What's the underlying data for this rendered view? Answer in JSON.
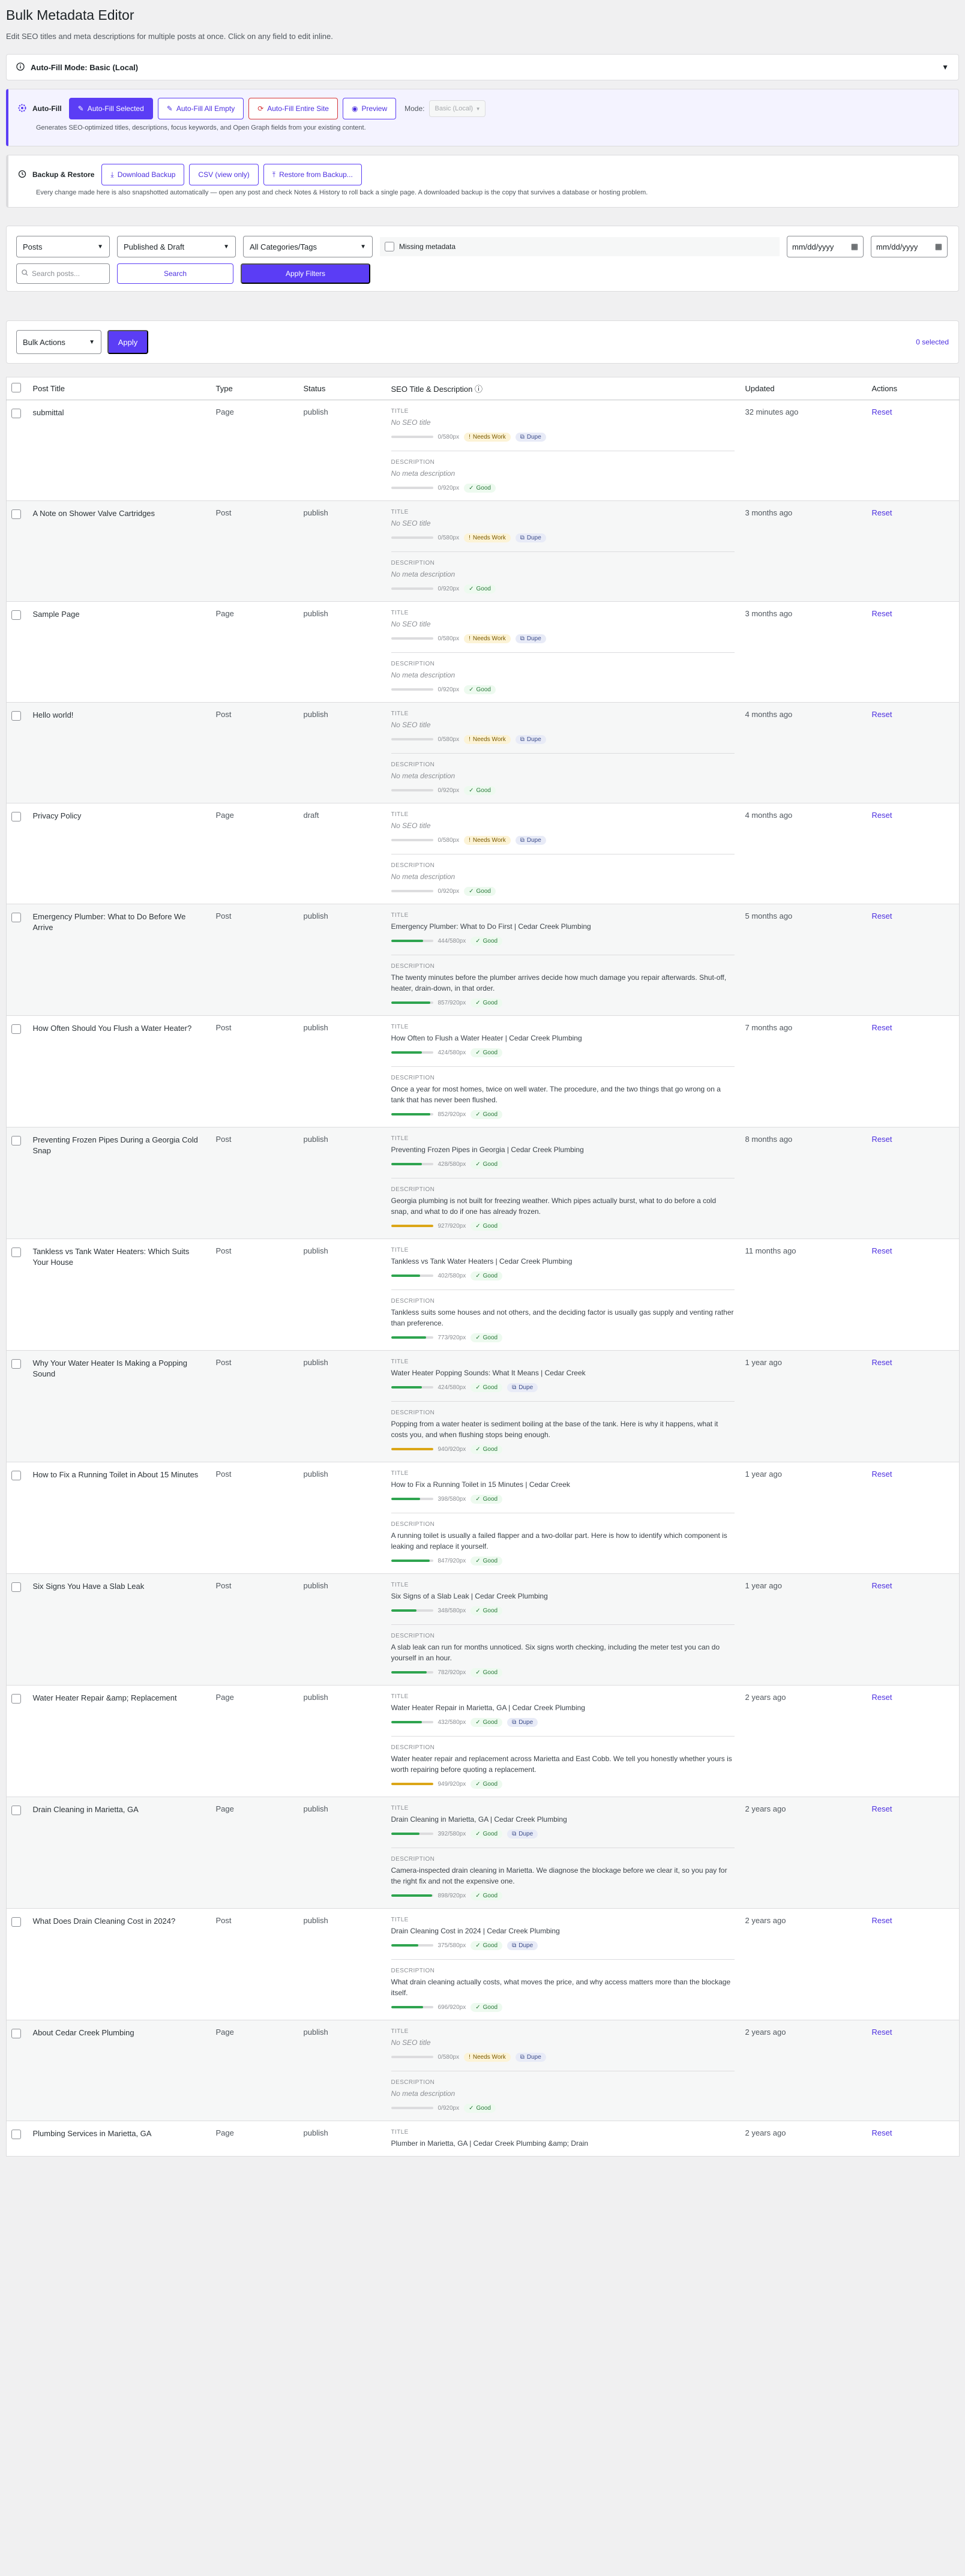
{
  "header": {
    "title": "Bulk Metadata Editor",
    "subtitle": "Edit SEO titles and meta descriptions for multiple posts at once. Click on any field to edit inline."
  },
  "autofill_mode": {
    "label": "Auto-Fill Mode: Basic (Local)",
    "expanded": false
  },
  "autofill": {
    "section_label": "Auto-Fill",
    "buttons": [
      "Auto-Fill Selected",
      "Auto-Fill All Empty",
      "Auto-Fill Entire Site",
      "Preview"
    ],
    "mode_label": "Mode:",
    "mode_value": "Basic (Local)",
    "help": "Generates SEO-optimized titles, descriptions, focus keywords, and Open Graph fields from your existing content."
  },
  "backup": {
    "section_label": "Backup & Restore",
    "buttons": [
      "Download Backup",
      "CSV (view only)",
      "Restore from Backup..."
    ],
    "help": "Every change made here is also snapshotted automatically — open any post and check Notes & History to roll back a single page. A downloaded backup is the copy that survives a database or hosting problem."
  },
  "filters": {
    "post_type": "Posts",
    "status": "Published & Draft",
    "category": "All Categories/Tags",
    "missing_label": "Missing metadata",
    "date_from": "mm/dd/yyyy",
    "date_to": "mm/dd/yyyy",
    "search_placeholder": "Search posts...",
    "search_label": "Search",
    "apply_label": "Apply Filters"
  },
  "bulk": {
    "action": "Bulk Actions",
    "apply": "Apply",
    "selected": "0 selected"
  },
  "table": {
    "columns": [
      "Post Title",
      "Type",
      "Status",
      "SEO Title & Description ⓘ",
      "Updated",
      "Actions"
    ],
    "title_label": "TITLE",
    "desc_label": "DESCRIPTION",
    "reset_label": "Reset",
    "badges": {
      "good": "Good",
      "needs": "Needs Work",
      "dupe": "Dupe"
    },
    "rows": [
      {
        "title": "submittal",
        "type": "Page",
        "status": "publish",
        "seo_title": "No SEO title",
        "title_px": "0/580px",
        "title_fill": 0,
        "title_badges": [
          "needs",
          "dupe"
        ],
        "desc": "No meta description",
        "desc_px": "0/920px",
        "desc_fill": 0,
        "desc_badges": [
          "good"
        ],
        "updated": "32 minutes ago"
      },
      {
        "title": "A Note on Shower Valve Cartridges",
        "type": "Post",
        "status": "publish",
        "seo_title": "No SEO title",
        "title_px": "0/580px",
        "title_fill": 0,
        "title_badges": [
          "needs",
          "dupe"
        ],
        "desc": "No meta description",
        "desc_px": "0/920px",
        "desc_fill": 0,
        "desc_badges": [
          "good"
        ],
        "updated": "3 months ago"
      },
      {
        "title": "Sample Page",
        "type": "Page",
        "status": "publish",
        "seo_title": "No SEO title",
        "title_px": "0/580px",
        "title_fill": 0,
        "title_badges": [
          "needs",
          "dupe"
        ],
        "desc": "No meta description",
        "desc_px": "0/920px",
        "desc_fill": 0,
        "desc_badges": [
          "good"
        ],
        "updated": "3 months ago"
      },
      {
        "title": "Hello world!",
        "type": "Post",
        "status": "publish",
        "seo_title": "No SEO title",
        "title_px": "0/580px",
        "title_fill": 0,
        "title_badges": [
          "needs",
          "dupe"
        ],
        "desc": "No meta description",
        "desc_px": "0/920px",
        "desc_fill": 0,
        "desc_badges": [
          "good"
        ],
        "updated": "4 months ago"
      },
      {
        "title": "Privacy Policy",
        "type": "Page",
        "status": "draft",
        "seo_title": "No SEO title",
        "title_px": "0/580px",
        "title_fill": 0,
        "title_badges": [
          "needs",
          "dupe"
        ],
        "desc": "No meta description",
        "desc_px": "0/920px",
        "desc_fill": 0,
        "desc_badges": [
          "good"
        ],
        "updated": "4 months ago"
      },
      {
        "title": "Emergency Plumber: What to Do Before We Arrive",
        "type": "Post",
        "status": "publish",
        "seo_title": "Emergency Plumber: What to Do First | Cedar Creek Plumbing",
        "title_px": "444/580px",
        "title_fill": 0.77,
        "title_badges": [
          "good"
        ],
        "desc": "The twenty minutes before the plumber arrives decide how much damage you repair afterwards. Shut-off, heater, drain-down, in that order.",
        "desc_px": "857/920px",
        "desc_fill": 0.93,
        "desc_badges": [
          "good"
        ],
        "updated": "5 months ago"
      },
      {
        "title": "How Often Should You Flush a Water Heater?",
        "type": "Post",
        "status": "publish",
        "seo_title": "How Often to Flush a Water Heater | Cedar Creek Plumbing",
        "title_px": "424/580px",
        "title_fill": 0.73,
        "title_badges": [
          "good"
        ],
        "desc": "Once a year for most homes, twice on well water. The procedure, and the two things that go wrong on a tank that has never been flushed.",
        "desc_px": "852/920px",
        "desc_fill": 0.93,
        "desc_badges": [
          "good"
        ],
        "updated": "7 months ago"
      },
      {
        "title": "Preventing Frozen Pipes During a Georgia Cold Snap",
        "type": "Post",
        "status": "publish",
        "seo_title": "Preventing Frozen Pipes in Georgia | Cedar Creek Plumbing",
        "title_px": "428/580px",
        "title_fill": 0.74,
        "title_badges": [
          "good"
        ],
        "desc": "Georgia plumbing is not built for freezing weather. Which pipes actually burst, what to do before a cold snap, and what to do if one has already frozen.",
        "desc_px": "927/920px",
        "desc_fill": 1.0,
        "desc_badges": [
          "good"
        ],
        "updated": "8 months ago"
      },
      {
        "title": "Tankless vs Tank Water Heaters: Which Suits Your House",
        "type": "Post",
        "status": "publish",
        "seo_title": "Tankless vs Tank Water Heaters | Cedar Creek Plumbing",
        "title_px": "402/580px",
        "title_fill": 0.69,
        "title_badges": [
          "good"
        ],
        "desc": "Tankless suits some houses and not others, and the deciding factor is usually gas supply and venting rather than preference.",
        "desc_px": "773/920px",
        "desc_fill": 0.84,
        "desc_badges": [
          "good"
        ],
        "updated": "11 months ago"
      },
      {
        "title": "Why Your Water Heater Is Making a Popping Sound",
        "type": "Post",
        "status": "publish",
        "seo_title": "Water Heater Popping Sounds: What It Means | Cedar Creek",
        "title_px": "424/580px",
        "title_fill": 0.73,
        "title_badges": [
          "good",
          "dupe"
        ],
        "desc": "Popping from a water heater is sediment boiling at the base of the tank. Here is why it happens, what it costs you, and when flushing stops being enough.",
        "desc_px": "940/920px",
        "desc_fill": 1.0,
        "desc_badges": [
          "good"
        ],
        "updated": "1 year ago"
      },
      {
        "title": "How to Fix a Running Toilet in About 15 Minutes",
        "type": "Post",
        "status": "publish",
        "seo_title": "How to Fix a Running Toilet in 15 Minutes | Cedar Creek",
        "title_px": "398/580px",
        "title_fill": 0.69,
        "title_badges": [
          "good"
        ],
        "desc": "A running toilet is usually a failed flapper and a two-dollar part. Here is how to identify which component is leaking and replace it yourself.",
        "desc_px": "847/920px",
        "desc_fill": 0.92,
        "desc_badges": [
          "good"
        ],
        "updated": "1 year ago"
      },
      {
        "title": "Six Signs You Have a Slab Leak",
        "type": "Post",
        "status": "publish",
        "seo_title": "Six Signs of a Slab Leak | Cedar Creek Plumbing",
        "title_px": "348/580px",
        "title_fill": 0.6,
        "title_badges": [
          "good"
        ],
        "desc": "A slab leak can run for months unnoticed. Six signs worth checking, including the meter test you can do yourself in an hour.",
        "desc_px": "782/920px",
        "desc_fill": 0.85,
        "desc_badges": [
          "good"
        ],
        "updated": "1 year ago"
      },
      {
        "title": "Water Heater Repair &amp; Replacement",
        "type": "Page",
        "status": "publish",
        "seo_title": "Water Heater Repair in Marietta, GA | Cedar Creek Plumbing",
        "title_px": "432/580px",
        "title_fill": 0.74,
        "title_badges": [
          "good",
          "dupe"
        ],
        "desc": "Water heater repair and replacement across Marietta and East Cobb. We tell you honestly whether yours is worth repairing before quoting a replacement.",
        "desc_px": "949/920px",
        "desc_fill": 1.0,
        "desc_badges": [
          "good"
        ],
        "updated": "2 years ago"
      },
      {
        "title": "Drain Cleaning in Marietta, GA",
        "type": "Page",
        "status": "publish",
        "seo_title": "Drain Cleaning in Marietta, GA | Cedar Creek Plumbing",
        "title_px": "392/580px",
        "title_fill": 0.68,
        "title_badges": [
          "good",
          "dupe"
        ],
        "desc": "Camera-inspected drain cleaning in Marietta. We diagnose the blockage before we clear it, so you pay for the right fix and not the expensive one.",
        "desc_px": "898/920px",
        "desc_fill": 0.98,
        "desc_badges": [
          "good"
        ],
        "updated": "2 years ago"
      },
      {
        "title": "What Does Drain Cleaning Cost in 2024?",
        "type": "Post",
        "status": "publish",
        "seo_title": "Drain Cleaning Cost in 2024 | Cedar Creek Plumbing",
        "title_px": "375/580px",
        "title_fill": 0.65,
        "title_badges": [
          "good",
          "dupe"
        ],
        "desc": "What drain cleaning actually costs, what moves the price, and why access matters more than the blockage itself.",
        "desc_px": "696/920px",
        "desc_fill": 0.76,
        "desc_badges": [
          "good"
        ],
        "updated": "2 years ago"
      },
      {
        "title": "About Cedar Creek Plumbing",
        "type": "Page",
        "status": "publish",
        "seo_title": "No SEO title",
        "title_px": "0/580px",
        "title_fill": 0,
        "title_badges": [
          "needs",
          "dupe"
        ],
        "desc": "No meta description",
        "desc_px": "0/920px",
        "desc_fill": 0,
        "desc_badges": [
          "good"
        ],
        "updated": "2 years ago"
      },
      {
        "title": "Plumbing Services in Marietta, GA",
        "type": "Page",
        "status": "publish",
        "seo_title": "Plumber in Marietta, GA | Cedar Creek Plumbing &amp; Drain",
        "title_px": "",
        "title_fill": 0,
        "title_badges": [],
        "desc": "",
        "desc_px": "",
        "desc_fill": 0,
        "desc_badges": [],
        "updated": "2 years ago"
      }
    ]
  },
  "colors": {
    "accent": "#5b3df5",
    "good": "#2ea44f",
    "warn": "#dba617",
    "empty_bar": "#dcdcde"
  }
}
